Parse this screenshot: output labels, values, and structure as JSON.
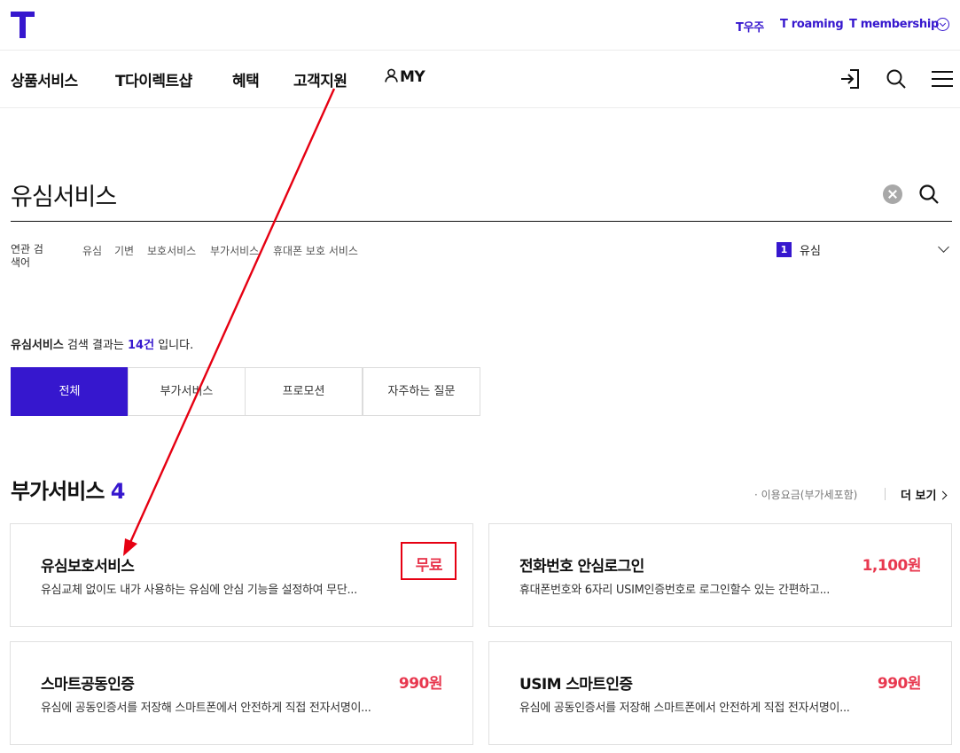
{
  "header": {
    "util_links": [
      "T우주",
      "T roaming",
      "T membership"
    ]
  },
  "gnb": {
    "items": [
      "상품서비스",
      "T다이렉트샵",
      "혜택",
      "고객지원",
      "MY"
    ]
  },
  "search": {
    "query": "유심서비스",
    "related_label": "연관 검색어",
    "related_keywords": [
      "유심",
      "기변",
      "보호서비스",
      "부가서비스",
      "휴대폰 보호 서비스"
    ],
    "rank": {
      "number": "1",
      "keyword": "유심"
    }
  },
  "result": {
    "query": "유심서비스",
    "text_mid": " 검색 결과는 ",
    "count": "14건",
    "text_end": " 입니다."
  },
  "tabs": [
    "전체",
    "부가서비스",
    "프로모션",
    "자주하는 질문"
  ],
  "section": {
    "title": "부가서비스",
    "count": "4",
    "price_note": "· 이용요금(부가세포함)",
    "more": "더 보기"
  },
  "cards": [
    {
      "title": "유심보호서비스",
      "desc": "유심교체 없이도 내가 사용하는 유심에 안심 기능을 설정하여 무단...",
      "price": "무료"
    },
    {
      "title": "전화번호 안심로그인",
      "desc": "휴대폰번호와 6자리 USIM인증번호로 로그인할수 있는 간편하고...",
      "price": "1,100원"
    },
    {
      "title": "스마트공동인증",
      "desc": "유심에 공동인증서를 저장해 스마트폰에서 안전하게 직접 전자서명이...",
      "price": "990원"
    },
    {
      "title": "USIM 스마트인증",
      "desc": "유심에 공동인증서를 저장해 스마트폰에서 안전하게 직접 전자서명이...",
      "price": "990원"
    }
  ],
  "colors": {
    "brand": "#3617ce",
    "price": "#e8384f",
    "annotation": "#e60012"
  }
}
